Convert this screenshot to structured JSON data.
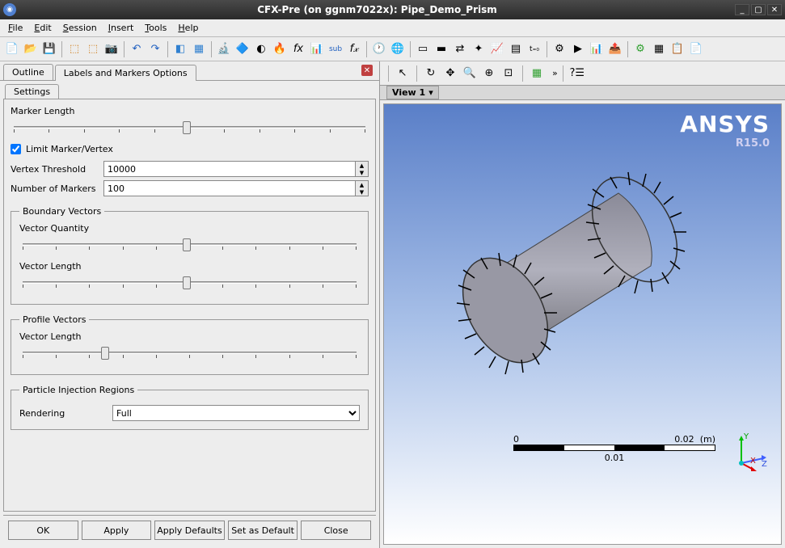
{
  "window": {
    "title": "CFX-Pre (on ggnm7022x):  Pipe_Demo_Prism"
  },
  "menubar": {
    "file": "File",
    "edit": "Edit",
    "session": "Session",
    "insert": "Insert",
    "tools": "Tools",
    "help": "Help"
  },
  "tabs": {
    "outline": "Outline",
    "labels_markers": "Labels and Markers Options"
  },
  "subtab": {
    "settings": "Settings"
  },
  "settings": {
    "marker_length_label": "Marker Length",
    "limit_marker_vertex_label": "Limit Marker/Vertex",
    "limit_marker_vertex_checked": true,
    "vertex_threshold_label": "Vertex Threshold",
    "vertex_threshold_value": "10000",
    "number_of_markers_label": "Number of Markers",
    "number_of_markers_value": "100",
    "boundary_vectors_legend": "Boundary Vectors",
    "vector_quantity_label": "Vector Quantity",
    "vector_length_label": "Vector Length",
    "profile_vectors_legend": "Profile Vectors",
    "profile_vector_length_label": "Vector Length",
    "particle_injection_legend": "Particle Injection Regions",
    "rendering_label": "Rendering",
    "rendering_value": "Full"
  },
  "buttons": {
    "ok": "OK",
    "apply": "Apply",
    "apply_defaults": "Apply Defaults",
    "set_as_default": "Set as Default",
    "close": "Close"
  },
  "view": {
    "view1_label": "View 1",
    "expand": "»"
  },
  "brand": {
    "name": "ANSYS",
    "version": "R15.0"
  },
  "scale": {
    "start": "0",
    "end": "0.02",
    "unit": "(m)",
    "mid": "0.01"
  },
  "triad": {
    "x": "X",
    "y": "Y",
    "z": "Z"
  }
}
